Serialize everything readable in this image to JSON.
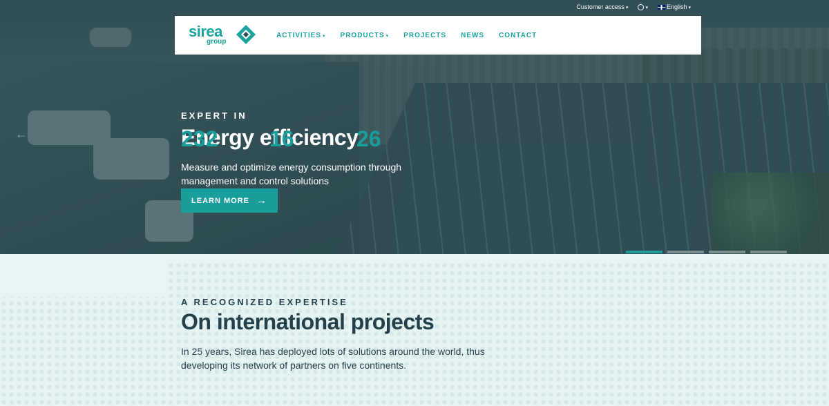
{
  "topbar": {
    "customer_access": "Customer access",
    "language": "English"
  },
  "nav": {
    "logo_text": "sirea",
    "logo_sub": "group",
    "items": [
      {
        "label": "ACTIVITIES",
        "dropdown": true
      },
      {
        "label": "PRODUCTS",
        "dropdown": true
      },
      {
        "label": "PROJECTS",
        "dropdown": false
      },
      {
        "label": "NEWS",
        "dropdown": false
      },
      {
        "label": "CONTACT",
        "dropdown": false
      }
    ]
  },
  "hero": {
    "kicker": "EXPERT IN",
    "title": "Energy efficiency",
    "description": "Measure and optimize energy consumption through management and control solutions",
    "button_label": "LEARN MORE",
    "prev_icon": "arrow-left-icon",
    "slides": 4,
    "active_slide": 1
  },
  "expertise": {
    "kicker": "A RECOGNIZED EXPERTISE",
    "title": "On international projects",
    "description": "In 25 years, Sirea has deployed lots of solutions around the world, thus developing its network of partners on five continents.",
    "stats": [
      "232",
      "16",
      "26"
    ]
  },
  "colors": {
    "brand": "#1a9e9b",
    "dark_text": "#24404a",
    "light_bg": "#e6f4f3"
  }
}
